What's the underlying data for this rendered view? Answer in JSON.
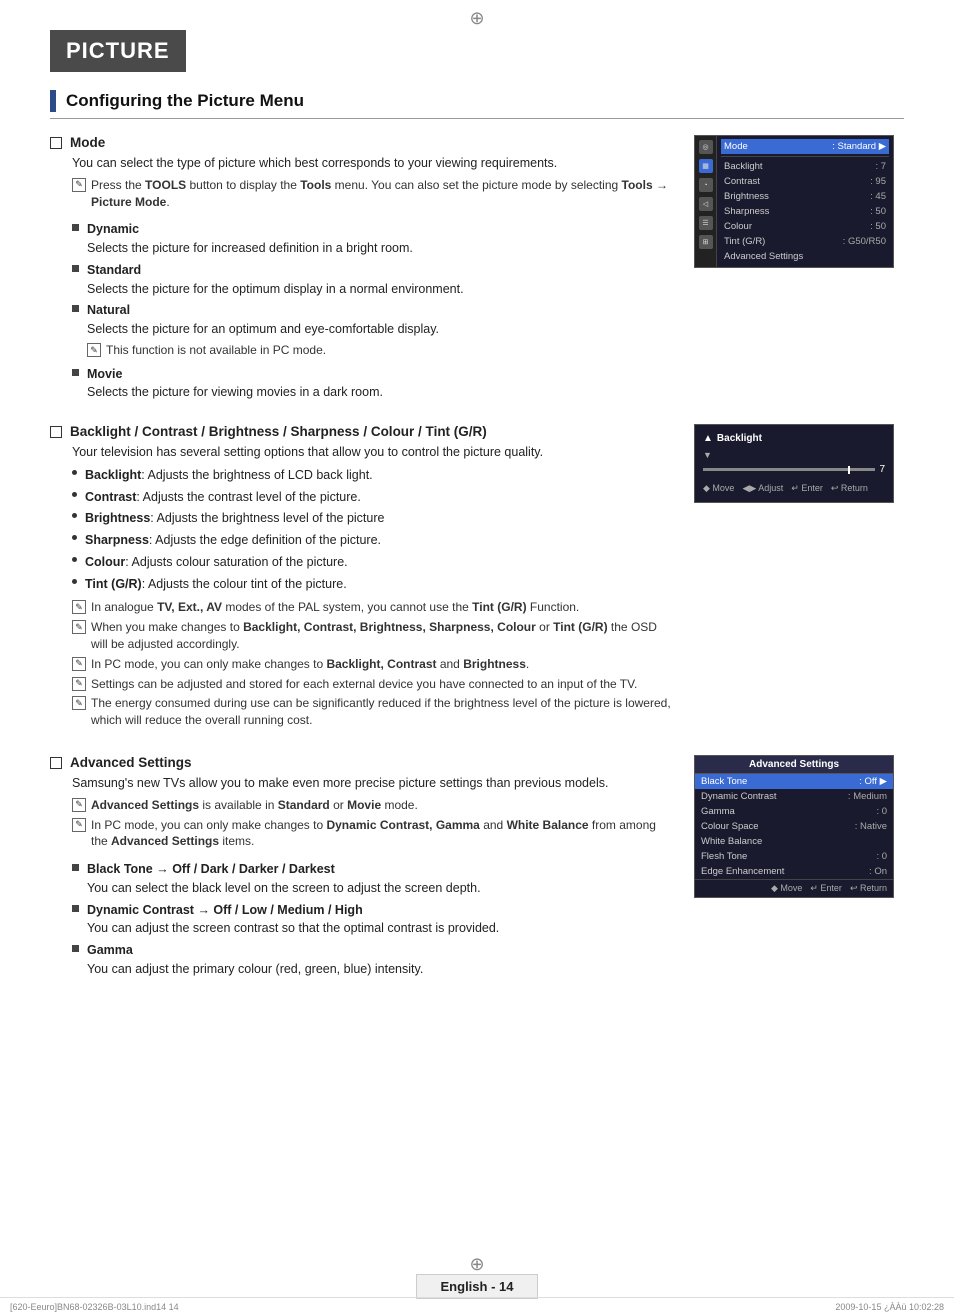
{
  "page": {
    "title": "PICTURE",
    "section_title": "Configuring the Picture Menu",
    "footer_label": "English - 14",
    "footer_left": "[620-Eeuro]BN68-02326B-03L10.ind14   14",
    "footer_right": "2009-10-15   ¿ÀÀü 10:02:28"
  },
  "mode_section": {
    "title": "Mode",
    "body": "You can select the type of picture which best corresponds to your viewing requirements.",
    "note": "Press the TOOLS button to display the Tools menu. You can also set the picture mode by selecting Tools → Picture Mode.",
    "sub_items": [
      {
        "title": "Dynamic",
        "body": "Selects the picture for increased definition in a bright room."
      },
      {
        "title": "Standard",
        "body": "Selects the picture for the optimum display in a normal environment."
      },
      {
        "title": "Natural",
        "body": "Selects the picture for an optimum and eye-comfortable display.",
        "note": "This function is not available in PC mode."
      },
      {
        "title": "Movie",
        "body": "Selects the picture for viewing movies in a dark room."
      }
    ]
  },
  "backlight_section": {
    "title": "Backlight / Contrast / Brightness / Sharpness / Colour / Tint (G/R)",
    "body": "Your television has several setting options that allow you to control the picture quality.",
    "bullets": [
      {
        "label": "Backlight",
        "text": ": Adjusts the brightness of LCD back light."
      },
      {
        "label": "Contrast",
        "text": ": Adjusts the contrast level of the picture."
      },
      {
        "label": "Brightness",
        "text": ": Adjusts the brightness level of the picture"
      },
      {
        "label": "Sharpness",
        "text": ": Adjusts the edge definition of the picture."
      },
      {
        "label": "Colour",
        "text": ": Adjusts colour saturation of the picture."
      },
      {
        "label": "Tint (G/R)",
        "text": ": Adjusts the colour tint of the picture."
      }
    ],
    "notes": [
      "In analogue TV, Ext., AV modes of the PAL system, you cannot use the Tint (G/R) Function.",
      "When you make changes to Backlight, Contrast, Brightness, Sharpness, Colour or Tint (G/R) the OSD will be adjusted accordingly.",
      "In PC mode, you can only make changes to Backlight, Contrast and Brightness.",
      "Settings can be adjusted and stored for each external device you have connected to an input of the TV.",
      "The energy consumed during use can be significantly reduced if the brightness level of the picture is lowered, which will reduce the overall running cost."
    ]
  },
  "advanced_section": {
    "title": "Advanced Settings",
    "body": "Samsung's new TVs allow you to make even more precise picture settings than previous models.",
    "notes": [
      "Advanced Settings is available in Standard or Movie mode.",
      "In PC mode, you can only make changes to Dynamic Contrast, Gamma and White Balance from among the Advanced Settings items."
    ],
    "sub_items": [
      {
        "title": "Black Tone → Off / Dark / Darker / Darkest",
        "body": "You can select the black level on the screen to adjust the screen depth."
      },
      {
        "title": "Dynamic Contrast → Off / Low / Medium / High",
        "body": "You can adjust the screen contrast so that the optimal contrast is provided."
      },
      {
        "title": "Gamma",
        "body": "You can adjust the primary colour (red, green, blue) intensity."
      }
    ]
  },
  "tv_menu": {
    "highlighted_row": "Mode",
    "highlighted_value": ": Standard",
    "rows": [
      {
        "label": "Mode",
        "value": ": Standard",
        "highlighted": true
      },
      {
        "label": "Backlight",
        "value": ": 7"
      },
      {
        "label": "Contrast",
        "value": ": 95"
      },
      {
        "label": "Brightness",
        "value": ": 45"
      },
      {
        "label": "Sharpness",
        "value": ": 50"
      },
      {
        "label": "Colour",
        "value": ": 50"
      },
      {
        "label": "Tint (G/R)",
        "value": ": G50/R50"
      },
      {
        "label": "Advanced Settings",
        "value": ""
      }
    ]
  },
  "backlight_widget": {
    "label": "Backlight",
    "value": "7",
    "nav_items": [
      "Move",
      "Adjust",
      "Enter",
      "Return"
    ]
  },
  "adv_menu": {
    "title": "Advanced Settings",
    "rows": [
      {
        "label": "Black Tone",
        "value": ": Off",
        "highlighted": true
      },
      {
        "label": "Dynamic Contrast",
        "value": ": Medium"
      },
      {
        "label": "Gamma",
        "value": ": 0"
      },
      {
        "label": "Colour Space",
        "value": ": Native"
      },
      {
        "label": "White Balance",
        "value": ""
      },
      {
        "label": "Flesh Tone",
        "value": ": 0"
      },
      {
        "label": "Edge Enhancement",
        "value": ": On"
      }
    ],
    "nav_items": [
      "Move",
      "Enter",
      "Return"
    ]
  }
}
